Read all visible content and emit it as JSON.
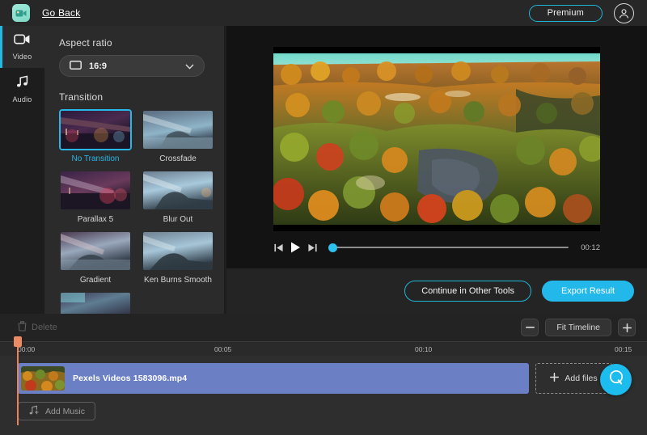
{
  "header": {
    "logo_icon": "camera-logo-icon",
    "go_back": "Go Back",
    "premium_label": "Premium",
    "avatar_icon": "user-avatar-icon"
  },
  "rail": {
    "items": [
      {
        "label": "Video",
        "icon": "video-camera-icon",
        "active": true
      },
      {
        "label": "Audio",
        "icon": "music-note-icon",
        "active": false
      }
    ]
  },
  "panel": {
    "aspect_ratio_label": "Aspect ratio",
    "aspect_ratio_value": "16:9",
    "aspect_ratio_icon": "rectangle-icon",
    "chevron_icon": "chevron-down-icon",
    "transition_label": "Transition",
    "transitions": [
      {
        "name": "No Transition",
        "selected": true
      },
      {
        "name": "Crossfade",
        "selected": false
      },
      {
        "name": "Parallax 5",
        "selected": false
      },
      {
        "name": "Blur Out",
        "selected": false
      },
      {
        "name": "Gradient",
        "selected": false
      },
      {
        "name": "Ken Burns Smooth",
        "selected": false
      }
    ]
  },
  "preview": {
    "skip_back_icon": "skip-back-icon",
    "play_icon": "play-icon",
    "skip_forward_icon": "skip-forward-icon",
    "progress_percent": 0,
    "duration": "00:12"
  },
  "actions": {
    "continue_label": "Continue in Other Tools",
    "export_label": "Export Result"
  },
  "timeline": {
    "delete_label": "Delete",
    "delete_icon": "trash-icon",
    "zoom_out_icon": "minus-icon",
    "zoom_in_icon": "plus-icon",
    "fit_label": "Fit Timeline",
    "ruler_ticks": [
      "00:00",
      "00:05",
      "00:10",
      "00:15"
    ],
    "clip_name": "Pexels Videos 1583096.mp4",
    "add_files_label": "Add files",
    "add_files_icon": "plus-icon",
    "add_music_label": "Add Music",
    "add_music_icon": "music-note-plus-icon",
    "support_icon": "chat-bubble-icon"
  },
  "colors": {
    "accent": "#22b8ea",
    "accent_outline": "#1fb6d8",
    "clip": "#6b80c4",
    "playhead": "#e8825c",
    "panel_bg": "#2b2b2b",
    "app_bg": "#1d1d1d"
  }
}
